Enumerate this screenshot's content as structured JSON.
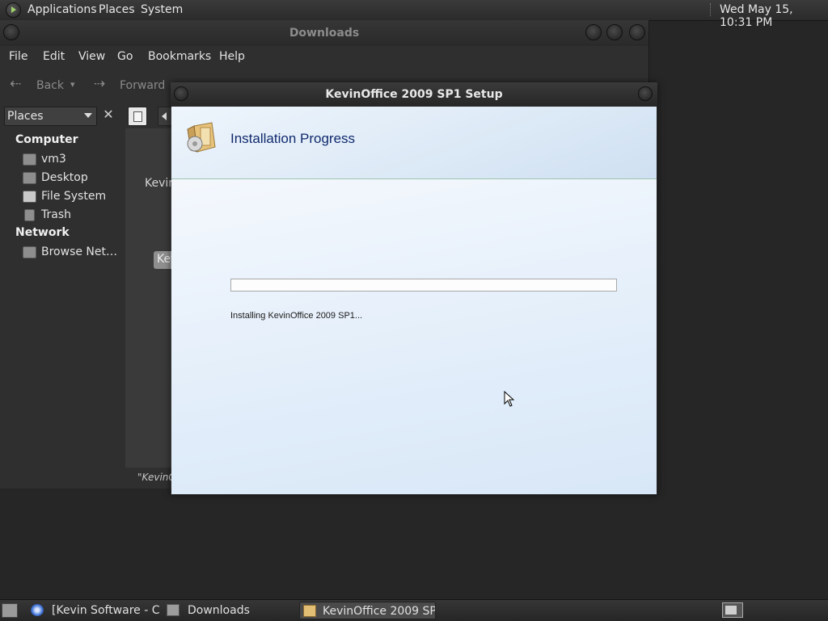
{
  "top_panel": {
    "menus": [
      "Applications",
      "Places",
      "System"
    ],
    "clock": "Wed May 15, 10:31 PM"
  },
  "file_manager": {
    "title": "Downloads",
    "menubar": [
      "File",
      "Edit",
      "View",
      "Go",
      "Bookmarks",
      "Help"
    ],
    "toolbar": {
      "back": "Back",
      "forward": "Forward"
    },
    "sidebar": {
      "selector": "Places",
      "close_glyph": "✕",
      "sections": [
        {
          "heading": "Computer",
          "items": [
            "vm3",
            "Desktop",
            "File System",
            "Trash"
          ]
        },
        {
          "heading": "Network",
          "items": [
            "Browse Net…"
          ]
        }
      ]
    },
    "content": {
      "file_label": "Kevin",
      "file_chip": "Kev",
      "status": "\"KevinOf"
    }
  },
  "setup_dialog": {
    "title": "KevinOffice 2009 SP1 Setup",
    "header_title": "Installation Progress",
    "progress": 0,
    "status": "Installing KevinOffice 2009 SP1..."
  },
  "taskbar": {
    "tasks": [
      "[Kevin Software - C…",
      "Downloads",
      "KevinOffice 2009 SP…"
    ]
  },
  "icons": {
    "logo": "os-logo-icon",
    "back": "arrow-left-icon",
    "forward": "arrow-right-icon",
    "setup": "installer-box-icon"
  }
}
